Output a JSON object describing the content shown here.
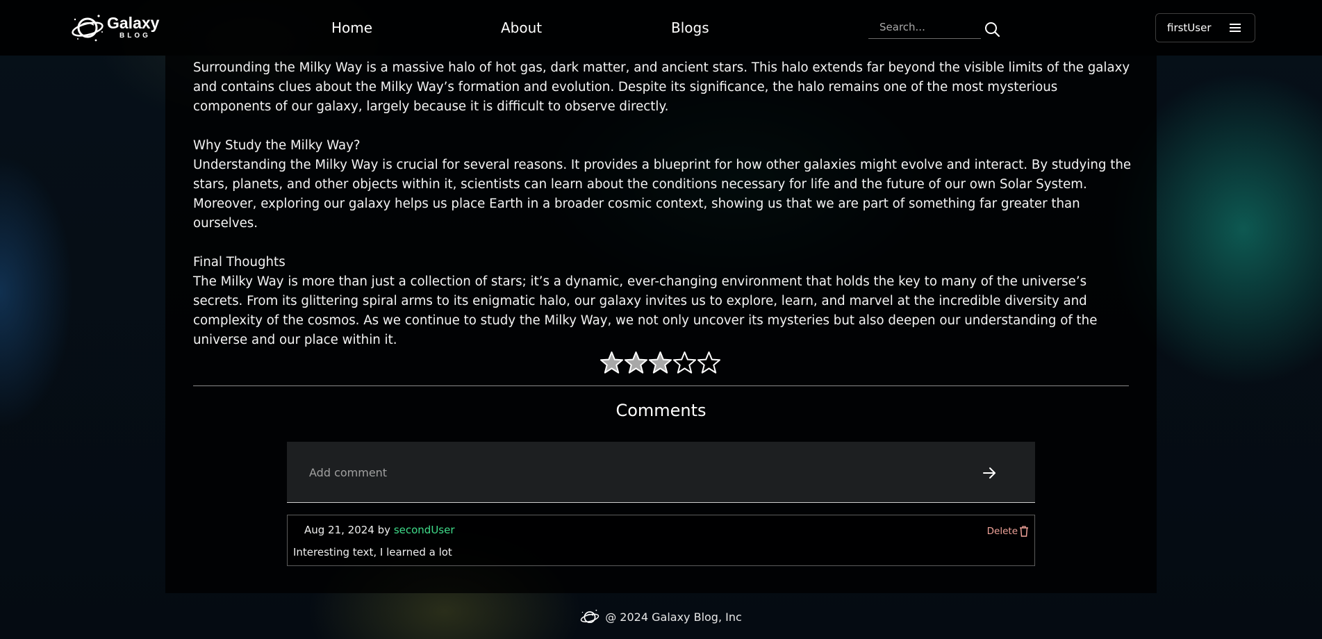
{
  "header": {
    "logo": {
      "title": "Galaxy",
      "subtitle": "BLOG"
    },
    "nav": [
      {
        "label": "Home"
      },
      {
        "label": "About"
      },
      {
        "label": "Blogs"
      }
    ],
    "search": {
      "placeholder": "Search...",
      "icon": "search-icon"
    },
    "user": {
      "name": "firstUser",
      "menu_icon": "hamburger-menu-icon"
    }
  },
  "article": {
    "paragraphs": [
      {
        "heading": "",
        "text": "Surrounding the Milky Way is a massive halo of hot gas, dark matter, and ancient stars. This halo extends far beyond the visible limits of the galaxy and contains clues about the Milky Way’s formation and evolution. Despite its significance, the halo remains one of the most mysterious components of our galaxy, largely because it is difficult to observe directly."
      },
      {
        "heading": "Why Study the Milky Way?",
        "text": "Understanding the Milky Way is crucial for several reasons. It provides a blueprint for how other galaxies might evolve and interact. By studying the stars, planets, and other objects within it, scientists can learn about the conditions necessary for life and the future of our own Solar System. Moreover, exploring our galaxy helps us place Earth in a broader cosmic context, showing us that we are part of something far greater than ourselves."
      },
      {
        "heading": "Final Thoughts",
        "text": "The Milky Way is more than just a collection of stars; it’s a dynamic, ever-changing environment that holds the key to many of the universe’s secrets. From its glittering spiral arms to its enigmatic halo, our galaxy invites us to explore, learn, and marvel at the incredible diversity and complexity of the cosmos. As we continue to study the Milky Way, we not only uncover its mysteries but also deepen our understanding of the universe and our place within it."
      }
    ]
  },
  "rating": {
    "value": 3,
    "max": 5
  },
  "comments": {
    "title": "Comments",
    "input_placeholder": "Add comment",
    "send_icon": "arrow-right-icon",
    "items": [
      {
        "date": "Aug 21, 2024",
        "by": "by",
        "author": "secondUser",
        "text": "Interesting text, I learned a lot",
        "delete_label": "Delete"
      }
    ]
  },
  "footer": {
    "text": "@ 2024 Galaxy Blog, Inc"
  },
  "colors": {
    "author_accent": "#3fdc8a",
    "delete_accent": "#f0a39a",
    "star_filled": "#a8a8a8",
    "star_empty": "#000000"
  }
}
